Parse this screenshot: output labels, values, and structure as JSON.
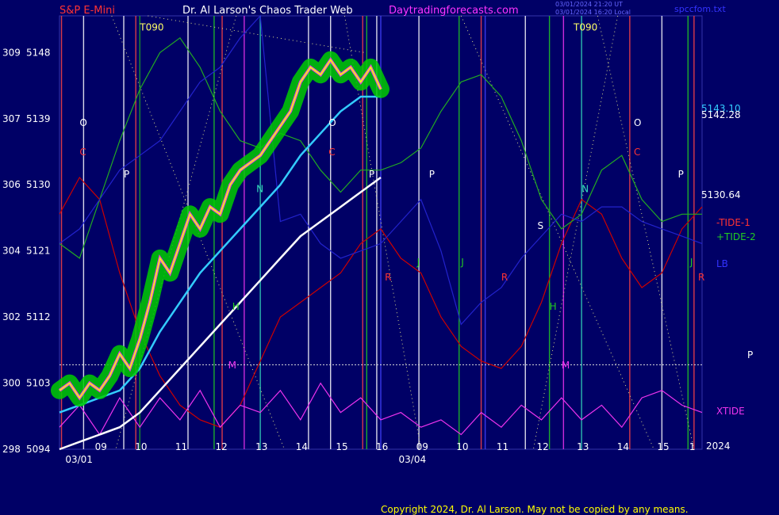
{
  "header": {
    "symbol": "S&P E-Mini",
    "title": "Dr. Al Larson's Chaos Trader Web",
    "site": "Daytradingforecasts.com",
    "timestamp_1": "03/01/2024 21:20 UT",
    "timestamp_2": "03/01/2024 16:20 Local",
    "filename": "spccfom.txt"
  },
  "footer": {
    "copyright": "Copyright 2024, Dr. Al Larson. May not be copied by any means."
  },
  "colors": {
    "background": "#000066",
    "price": "#ffff00",
    "price_band": "#00cc00",
    "cyan_avg": "#33ccff",
    "white_avg": "#ffffff",
    "tide_minus": "#cc0000",
    "tide_plus": "#22aa22",
    "xtide": "#ee33ee",
    "lb": "#2222cc",
    "dotted": "#dddd88"
  },
  "chart_data": {
    "type": "line",
    "title": "S&P E-Mini",
    "x_unit": "hour",
    "xlim": [
      8,
      15.4
    ],
    "ylim": [
      5094,
      5153
    ],
    "grid": false,
    "ticks_y": [
      {
        "left": "298",
        "price": "5094",
        "value": 5094
      },
      {
        "left": "300",
        "price": "5103",
        "value": 5103
      },
      {
        "left": "302",
        "price": "5112",
        "value": 5112
      },
      {
        "left": "304",
        "price": "5121",
        "value": 5121
      },
      {
        "left": "306",
        "price": "5130",
        "value": 5130
      },
      {
        "left": "307",
        "price": "5139",
        "value": 5139
      },
      {
        "left": "309",
        "price": "5148",
        "value": 5148
      }
    ],
    "ticks_x": [
      {
        "label": "09",
        "value": 9
      },
      {
        "label": "10",
        "value": 10
      },
      {
        "label": "11",
        "value": 11
      },
      {
        "label": "12",
        "value": 12
      },
      {
        "label": "13",
        "value": 13
      },
      {
        "label": "14",
        "value": 14
      },
      {
        "label": "15",
        "value": 15
      },
      {
        "label": "16",
        "value": 16
      },
      {
        "label": "09",
        "value": 17
      },
      {
        "label": "10",
        "value": 18
      },
      {
        "label": "11",
        "value": 19
      },
      {
        "label": "12",
        "value": 20
      },
      {
        "label": "13",
        "value": 21
      },
      {
        "label": "14",
        "value": 22
      },
      {
        "label": "15",
        "value": 23
      },
      {
        "label": "1",
        "value": 23.8
      }
    ],
    "date_labels": [
      {
        "label": "03/01",
        "value": 8.5
      },
      {
        "label": "03/04",
        "value": 16.8
      }
    ],
    "year_label": "2024",
    "price_labels": [
      "5143.10",
      "5142.28",
      "5130.64"
    ],
    "series": [
      {
        "name": "-TIDE-1",
        "color": "#cc0000",
        "x": [
          8,
          8.5,
          9,
          9.5,
          10,
          10.5,
          11,
          11.5,
          12,
          12.5,
          13,
          13.5,
          14,
          14.5,
          15,
          15.5,
          16,
          16.5,
          17,
          17.5,
          18,
          18.5,
          19,
          19.5,
          20,
          20.5,
          21,
          21.5,
          22,
          22.5,
          23,
          23.5,
          24
        ],
        "y": [
          5126,
          5131,
          5128,
          5118,
          5110,
          5104,
          5100,
          5098,
          5097,
          5100,
          5106,
          5112,
          5114,
          5116,
          5118,
          5122,
          5124,
          5120,
          5118,
          5112,
          5108,
          5106,
          5105,
          5108,
          5114,
          5122,
          5128,
          5126,
          5120,
          5116,
          5118,
          5124,
          5127
        ]
      },
      {
        "name": "+TIDE-2",
        "color": "#22aa22",
        "x": [
          8,
          8.5,
          9,
          9.5,
          10,
          10.5,
          11,
          11.5,
          12,
          12.5,
          13,
          13.5,
          14,
          14.5,
          15,
          15.5,
          16,
          16.5,
          17,
          17.5,
          18,
          18.5,
          19,
          19.5,
          20,
          20.5,
          21,
          21.5,
          22,
          22.5,
          23,
          23.5,
          24
        ],
        "y": [
          5122,
          5120,
          5128,
          5136,
          5143,
          5148,
          5150,
          5146,
          5140,
          5136,
          5135,
          5137,
          5136,
          5132,
          5129,
          5132,
          5132,
          5133,
          5135,
          5140,
          5144,
          5145,
          5142,
          5136,
          5128,
          5124,
          5126,
          5132,
          5134,
          5128,
          5125,
          5126,
          5126
        ]
      },
      {
        "name": "XTIDE",
        "color": "#ee33ee",
        "x": [
          8,
          8.5,
          9,
          9.5,
          10,
          10.5,
          11,
          11.5,
          12,
          12.5,
          13,
          13.5,
          14,
          14.5,
          15,
          15.5,
          16,
          16.5,
          17,
          17.5,
          18,
          18.5,
          19,
          19.5,
          20,
          20.5,
          21,
          21.5,
          22,
          22.5,
          23,
          23.5,
          24
        ],
        "y": [
          5097,
          5100,
          5096,
          5101,
          5097,
          5101,
          5098,
          5102,
          5097,
          5100,
          5099,
          5102,
          5098,
          5103,
          5099,
          5101,
          5098,
          5099,
          5097,
          5098,
          5096,
          5099,
          5097,
          5100,
          5098,
          5101,
          5098,
          5100,
          5097,
          5101,
          5102,
          5100,
          5099
        ]
      },
      {
        "name": "LB",
        "color": "#2222cc",
        "x": [
          8,
          8.5,
          9,
          9.5,
          10,
          10.5,
          11,
          11.5,
          12,
          12.5,
          13,
          13.5,
          14,
          14.5,
          15,
          15.5,
          16,
          16.5,
          17,
          17.5,
          18,
          18.5,
          19,
          19.5,
          20,
          20.5,
          21,
          21.5,
          22,
          22.5,
          23,
          23.5,
          24
        ],
        "y": [
          5122,
          5124,
          5128,
          5132,
          5134,
          5136,
          5140,
          5144,
          5146,
          5150,
          5153,
          5125,
          5126,
          5122,
          5120,
          5121,
          5122,
          5125,
          5128,
          5121,
          5111,
          5114,
          5116,
          5120,
          5123,
          5126,
          5125,
          5127,
          5127,
          5125,
          5124,
          5123,
          5122
        ]
      },
      {
        "name": "Price",
        "color": "#ffff00",
        "x": [
          8,
          8.25,
          8.5,
          8.75,
          9,
          9.25,
          9.5,
          9.75,
          10,
          10.25,
          10.5,
          10.75,
          11,
          11.25,
          11.5,
          11.75,
          12,
          12.25,
          12.5,
          12.75,
          13,
          13.25,
          13.5,
          13.75,
          14,
          14.25,
          14.5,
          14.75,
          15,
          15.25,
          15.5,
          15.75,
          16
        ],
        "y": [
          5102,
          5103,
          5101,
          5103,
          5102,
          5104,
          5107,
          5105,
          5109,
          5114,
          5120,
          5118,
          5122,
          5126,
          5124,
          5127,
          5126,
          5130,
          5132,
          5133,
          5134,
          5136,
          5138,
          5140,
          5144,
          5146,
          5145,
          5147,
          5145,
          5146,
          5144,
          5146,
          5143
        ]
      },
      {
        "name": "Cyan average",
        "color": "#33ccff",
        "x": [
          8,
          8.5,
          9,
          9.5,
          10,
          10.5,
          11,
          11.5,
          12,
          12.5,
          13,
          13.5,
          14,
          14.5,
          15,
          15.5,
          16
        ],
        "y": [
          5099,
          5100,
          5101,
          5102,
          5105,
          5110,
          5114,
          5118,
          5121,
          5124,
          5127,
          5130,
          5134,
          5137,
          5140,
          5142,
          5142
        ]
      },
      {
        "name": "White average",
        "color": "#ffffff",
        "x": [
          8,
          8.5,
          9,
          9.5,
          10,
          10.5,
          11,
          11.5,
          12,
          12.5,
          13,
          13.5,
          14,
          14.5,
          15,
          15.5,
          16
        ],
        "y": [
          5094,
          5095,
          5096,
          5097,
          5099,
          5102,
          5105,
          5108,
          5111,
          5114,
          5117,
          5120,
          5123,
          5125,
          5127,
          5129,
          5131
        ]
      }
    ],
    "vertical_markers": [
      {
        "x": 8.05,
        "color": "#ff4444"
      },
      {
        "x": 8.6,
        "color": "#ffffff"
      },
      {
        "x": 9.6,
        "color": "#ffffff"
      },
      {
        "x": 9.9,
        "color": "#ff4444"
      },
      {
        "x": 10.0,
        "color": "#22aa22"
      },
      {
        "x": 11.2,
        "color": "#ffffff"
      },
      {
        "x": 11.85,
        "color": "#22cc22"
      },
      {
        "x": 12.05,
        "color": "#ff4444"
      },
      {
        "x": 12.6,
        "color": "#ee33ee"
      },
      {
        "x": 13.0,
        "color": "#33ddbb"
      },
      {
        "x": 14.2,
        "color": "#ffffff"
      },
      {
        "x": 14.75,
        "color": "#ffffff"
      },
      {
        "x": 15.55,
        "color": "#ff4444"
      },
      {
        "x": 15.65,
        "color": "#22cc22"
      },
      {
        "x": 15.9,
        "color": "#ffffff"
      },
      {
        "x": 16.0,
        "color": "#4444ff"
      },
      {
        "x": 16.95,
        "color": "#ffffff"
      },
      {
        "x": 17.95,
        "color": "#22cc22"
      },
      {
        "x": 18.5,
        "color": "#ff4444"
      },
      {
        "x": 18.6,
        "color": "#4444ff"
      },
      {
        "x": 19.6,
        "color": "#ffffff"
      },
      {
        "x": 20.2,
        "color": "#22cc22"
      },
      {
        "x": 20.55,
        "color": "#ee33ee"
      },
      {
        "x": 21.0,
        "color": "#33ddbb"
      },
      {
        "x": 22.2,
        "color": "#ff4444"
      },
      {
        "x": 23.0,
        "color": "#ffffff"
      },
      {
        "x": 23.65,
        "color": "#22cc22"
      },
      {
        "x": 23.8,
        "color": "#ff4444"
      }
    ],
    "point_labels": [
      {
        "label": "T090",
        "x": 10.0,
        "y": 5151,
        "color": "#ffff66"
      },
      {
        "label": "T090",
        "x": 20.8,
        "y": 5151,
        "color": "#ffff66"
      },
      {
        "label": "O",
        "x": 8.5,
        "y": 5138,
        "color": "#ffffff"
      },
      {
        "label": "O",
        "x": 14.7,
        "y": 5138,
        "color": "#ffffff"
      },
      {
        "label": "O",
        "x": 22.3,
        "y": 5138,
        "color": "#ffffff"
      },
      {
        "label": "C",
        "x": 8.5,
        "y": 5134,
        "color": "#ff3333"
      },
      {
        "label": "C",
        "x": 14.7,
        "y": 5134,
        "color": "#ff3333"
      },
      {
        "label": "C",
        "x": 22.3,
        "y": 5134,
        "color": "#ff3333"
      },
      {
        "label": "P",
        "x": 9.6,
        "y": 5131,
        "color": "#ffffff"
      },
      {
        "label": "P",
        "x": 15.7,
        "y": 5131,
        "color": "#ffffff"
      },
      {
        "label": "P",
        "x": 17.2,
        "y": 5131,
        "color": "#ffffff"
      },
      {
        "label": "P",
        "x": 23.4,
        "y": 5131,
        "color": "#ffffff"
      },
      {
        "label": "N",
        "x": 12.9,
        "y": 5129,
        "color": "#33ddbb"
      },
      {
        "label": "N",
        "x": 21.0,
        "y": 5129,
        "color": "#33ddbb"
      },
      {
        "label": "S",
        "x": 19.9,
        "y": 5124,
        "color": "#ffffff"
      },
      {
        "label": "J",
        "x": 16.9,
        "y": 5119,
        "color": "#22cc22"
      },
      {
        "label": "J",
        "x": 18.0,
        "y": 5119,
        "color": "#22cc22"
      },
      {
        "label": "J",
        "x": 23.7,
        "y": 5119,
        "color": "#22cc22"
      },
      {
        "label": "R",
        "x": 16.1,
        "y": 5117,
        "color": "#ff3333"
      },
      {
        "label": "R",
        "x": 19.0,
        "y": 5117,
        "color": "#ff3333"
      },
      {
        "label": "R",
        "x": 23.9,
        "y": 5117,
        "color": "#ff3333"
      },
      {
        "label": "H",
        "x": 12.3,
        "y": 5113,
        "color": "#22cc22"
      },
      {
        "label": "H",
        "x": 20.2,
        "y": 5113,
        "color": "#22cc22"
      },
      {
        "label": "M",
        "x": 12.2,
        "y": 5105,
        "color": "#ee33ee"
      },
      {
        "label": "M",
        "x": 20.5,
        "y": 5105,
        "color": "#ee33ee"
      }
    ],
    "legend": [
      {
        "label": "-TIDE-1",
        "color": "#ff3333"
      },
      {
        "label": "+TIDE-2",
        "color": "#22cc22"
      },
      {
        "label": "LB",
        "color": "#3333ff"
      },
      {
        "label": "P",
        "color": "#ffffff"
      },
      {
        "label": "XTIDE",
        "color": "#ee33ee"
      }
    ]
  }
}
